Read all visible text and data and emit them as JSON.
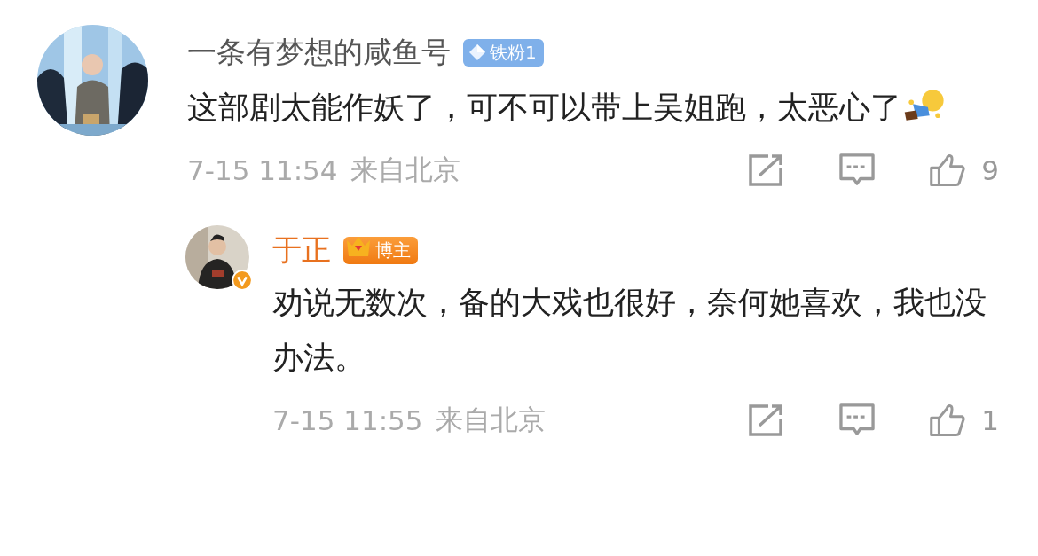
{
  "comment": {
    "name": "一条有梦想的咸鱼号",
    "badge": {
      "kind": "fan",
      "label": "铁粉1"
    },
    "text": "这部剧太能作妖了，可不可以带上吴姐跑，太恶心了",
    "time": "7-15 11:54",
    "location": "来自北京",
    "likes": "9",
    "replies": [
      {
        "name": "于正",
        "badge": {
          "kind": "blogger",
          "label": "博主"
        },
        "verified": true,
        "text": "劝说无数次，备的大戏也很好，奈何她喜欢，我也没办法。",
        "time": "7-15 11:55",
        "location": "来自北京",
        "likes": "1"
      }
    ]
  }
}
